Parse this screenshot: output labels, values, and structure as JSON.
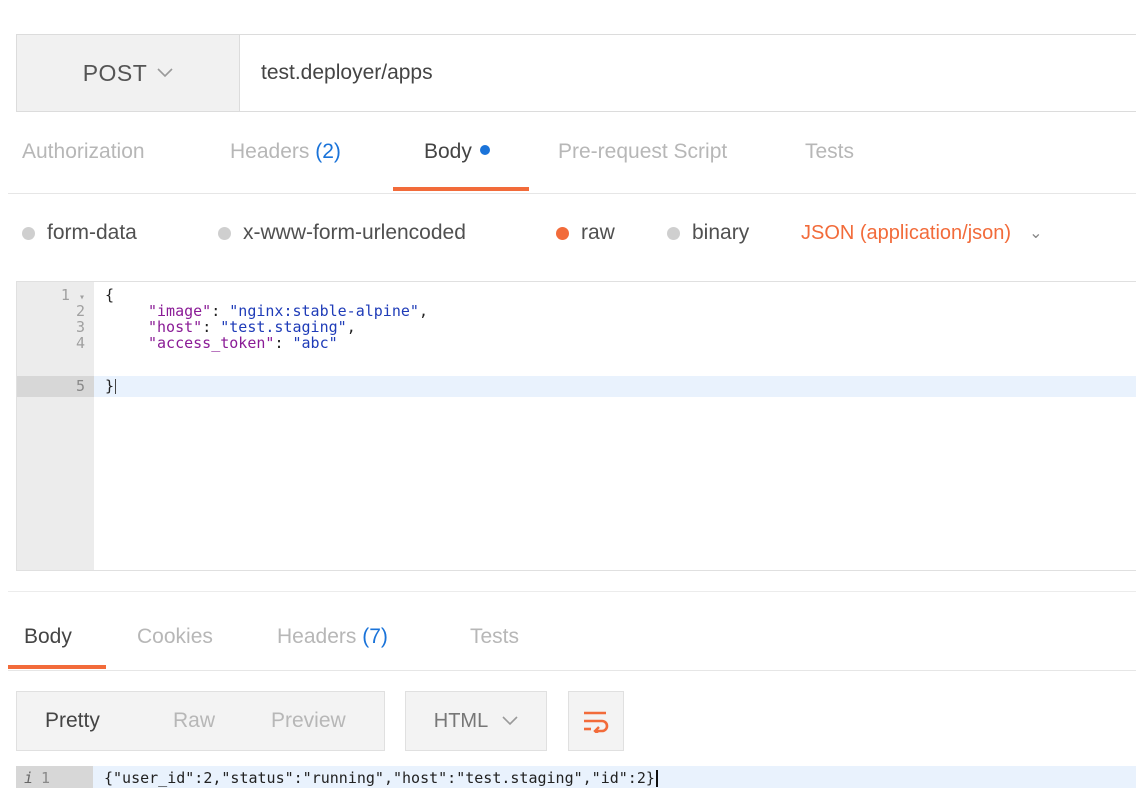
{
  "request": {
    "method": "POST",
    "url": "test.deployer/apps",
    "tabs": [
      {
        "label": "Authorization",
        "count": ""
      },
      {
        "label": "Headers",
        "count": "(2)"
      },
      {
        "label": "Body",
        "count": ""
      },
      {
        "label": "Pre-request Script",
        "count": ""
      },
      {
        "label": "Tests",
        "count": ""
      }
    ],
    "active_tab": "Body",
    "body_types": [
      "form-data",
      "x-www-form-urlencoded",
      "raw",
      "binary"
    ],
    "selected_body_type": "raw",
    "content_type": "JSON (application/json)",
    "line_numbers": [
      "1",
      "2",
      "3",
      "4",
      "5"
    ],
    "code": {
      "open": "{",
      "image_key": "\"image\"",
      "image_val": "\"nginx:stable-alpine\"",
      "host_key": "\"host\"",
      "host_val": "\"test.staging\"",
      "token_key": "\"access_token\"",
      "token_val": "\"abc\"",
      "close": "}"
    }
  },
  "response": {
    "tabs": [
      {
        "label": "Body",
        "count": ""
      },
      {
        "label": "Cookies",
        "count": ""
      },
      {
        "label": "Headers",
        "count": "(7)"
      },
      {
        "label": "Tests",
        "count": ""
      }
    ],
    "active_tab": "Body",
    "view_modes": [
      "Pretty",
      "Raw",
      "Preview"
    ],
    "active_view_mode": "Pretty",
    "format": "HTML",
    "line_number": "1",
    "info_marker": "i",
    "body": "{\"user_id\":2,\"status\":\"running\",\"host\":\"test.staging\",\"id\":2}"
  },
  "colors": {
    "accent": "#f26b3a",
    "count_blue": "#1a73d9",
    "json_key": "#8a1b96",
    "json_string": "#1f3cb8"
  }
}
